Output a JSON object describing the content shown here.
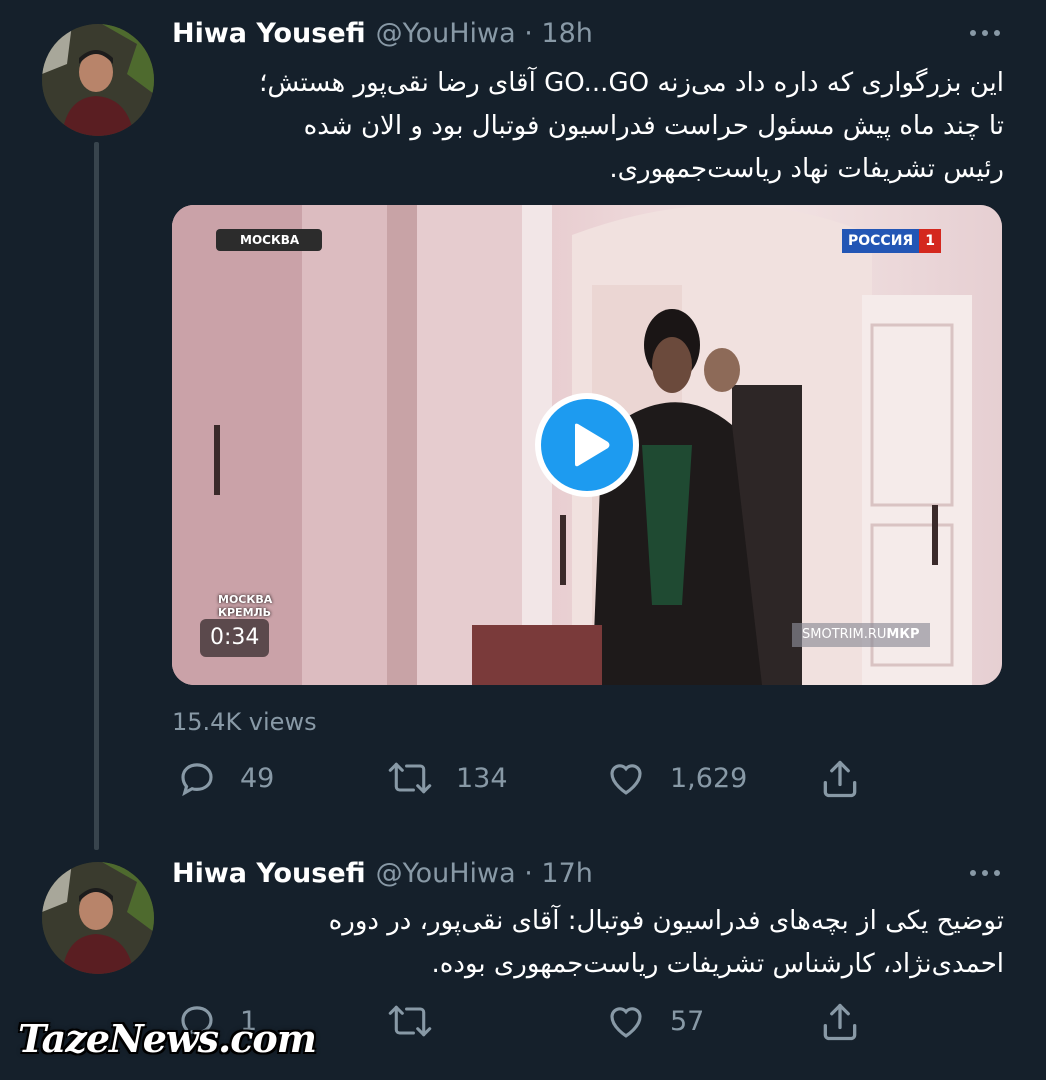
{
  "tweets": [
    {
      "name": "Hiwa Yousefi",
      "handle": "@YouHiwa",
      "separator": " · ",
      "time": "18h",
      "lines": [
        "این بزرگواری که داره داد می‌زنه GO...GO آقای رضا نقی‌پور هستش؛",
        "تا چند ماه پیش مسئول حراست فدراسیون فوتبال بود و الان شده",
        "رئیس تشریفات نهاد ریاست‌جمهوری."
      ],
      "video": {
        "channel_top_left": "МОСКВА",
        "channel_logo": "РОССИЯ",
        "channel_number": "1",
        "location_badge_line1": "МОСКВА",
        "location_badge_line2": "КРЕМЛЬ",
        "duration": "0:34",
        "source_caption": "SMOTRIM.RU",
        "source_caption_suffix": "МКР"
      },
      "views": "15.4K views",
      "replies": "49",
      "retweets": "134",
      "likes": "1,629"
    },
    {
      "name": "Hiwa Yousefi",
      "handle": "@YouHiwa",
      "separator": " · ",
      "time": "17h",
      "lines": [
        "توضیح یکی از بچه‌های فدراسیون فوتبال: آقای نقی‌پور، در دوره",
        "احمدی‌نژاد، کارشناس تشریفات ریاست‌جمهوری بوده."
      ],
      "replies": "1",
      "retweets": "",
      "likes": "57"
    }
  ],
  "watermark": "TazeNews.com",
  "colors": {
    "background": "#15202b",
    "secondary_text": "#8899a6",
    "play_button": "#1d9bf0",
    "thread_line": "#38444d"
  },
  "icons": [
    "reply-icon",
    "retweet-icon",
    "like-icon",
    "share-icon",
    "more-icon",
    "play-icon"
  ]
}
